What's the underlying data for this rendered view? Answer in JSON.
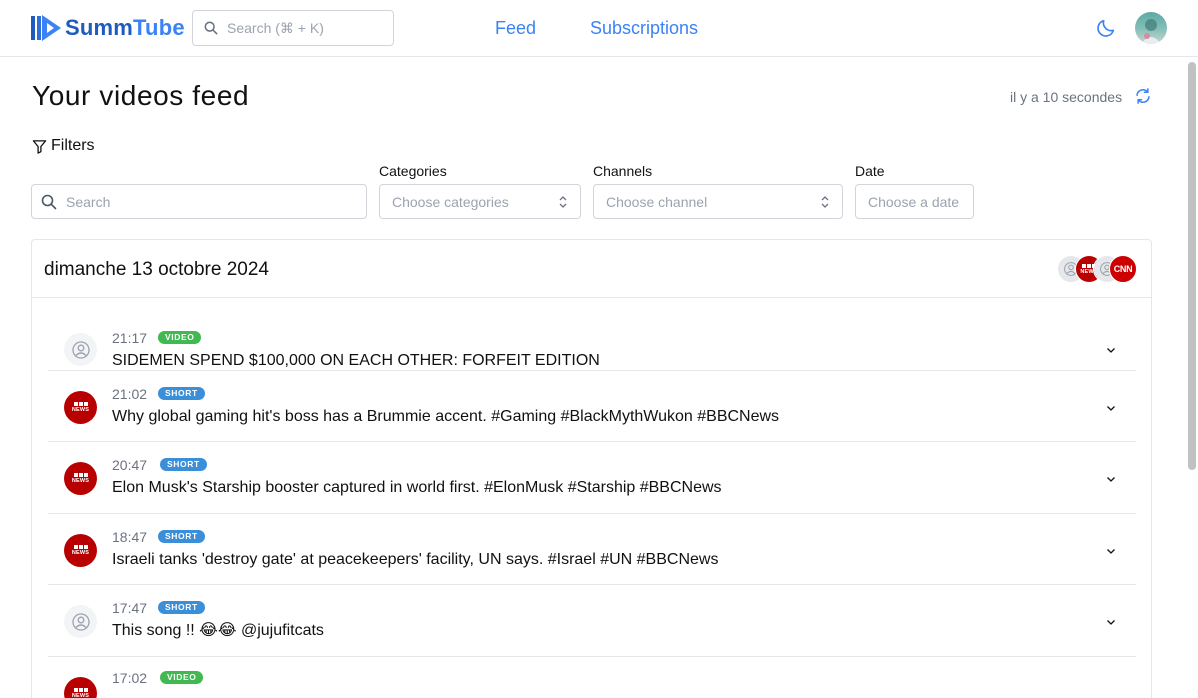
{
  "brand": {
    "name_part1": "Summ",
    "name_part2": "Tube",
    "color": "#1e5bbf",
    "accent": "#3b82f6"
  },
  "header": {
    "search_placeholder": "Search (⌘ + K)",
    "nav": [
      {
        "label": "Feed"
      },
      {
        "label": "Subscriptions"
      }
    ],
    "theme_icon": "moon-icon",
    "avatar_icon": "user-avatar"
  },
  "page": {
    "title": "Your videos feed",
    "updated": "il y a 10 secondes",
    "refresh_icon": "refresh-icon"
  },
  "filters": {
    "toggle_label": "Filters",
    "search_placeholder": "Search",
    "categories": {
      "label": "Categories",
      "placeholder": "Choose categories"
    },
    "channels": {
      "label": "Channels",
      "placeholder": "Choose channel"
    },
    "date": {
      "label": "Date",
      "placeholder": "Choose a date"
    }
  },
  "feed": {
    "day_title": "dimanche 13 octobre 2024",
    "channel_avatars": [
      "generic-user",
      "bbc-news",
      "generic-user",
      "cnn"
    ],
    "items": [
      {
        "time": "21:17",
        "type": "VIDEO",
        "channel": "generic-user",
        "title": "SIDEMEN SPEND $100,000 ON EACH OTHER: FORFEIT EDITION"
      },
      {
        "time": "21:02",
        "type": "SHORT",
        "channel": "bbc-news",
        "title": "Why global gaming hit's boss has a Brummie accent. #Gaming #BlackMythWukon #BBCNews"
      },
      {
        "time": "20:47",
        "type": "SHORT",
        "channel": "bbc-news",
        "title": "Elon Musk's Starship booster captured in world first. #ElonMusk #Starship #BBCNews"
      },
      {
        "time": "18:47",
        "type": "SHORT",
        "channel": "bbc-news",
        "title": "Israeli tanks 'destroy gate' at peacekeepers' facility, UN says. #Israel #UN #BBCNews"
      },
      {
        "time": "17:47",
        "type": "SHORT",
        "channel": "generic-user",
        "title": "This song !! 😂😂 @jujufitcats"
      },
      {
        "time": "17:02",
        "type": "VIDEO",
        "channel": "bbc-news",
        "title": ""
      }
    ]
  },
  "colors": {
    "video_badge": "#3fb950",
    "short_badge": "#3b8ed8",
    "bbc_red": "#b80000",
    "cnn_red": "#cc0000"
  }
}
